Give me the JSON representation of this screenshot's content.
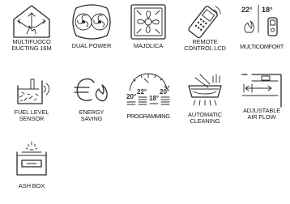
{
  "features": [
    {
      "id": "multifuoco",
      "icon": "house-airflow-icon",
      "label": "MULTIFUOCO\nDUCTING 16M"
    },
    {
      "id": "dual_power",
      "icon": "dual-fan-icon",
      "label": "DUAL POWER"
    },
    {
      "id": "majolica",
      "icon": "majolica-tile-icon",
      "label": "MAJOLICA"
    },
    {
      "id": "remote",
      "icon": "remote-control-icon",
      "label": "REMOTE\nCONTROL LCD"
    },
    {
      "id": "multicomfort",
      "icon": "thermostat-icon",
      "label": "MULTICOMFORT",
      "temps": [
        "22°",
        "18°"
      ]
    },
    {
      "id": "fuel_level",
      "icon": "fuel-level-icon",
      "label": "FUEL LEVEL\nSENSOR"
    },
    {
      "id": "energy_saving",
      "icon": "euro-flame-icon",
      "label": "ENERGY\nSAVING"
    },
    {
      "id": "programming",
      "icon": "programming-clock-icon",
      "label": "PROGRAMMING",
      "temps": [
        "20°",
        "22°",
        "18°",
        "20°"
      ]
    },
    {
      "id": "auto_cleaning",
      "icon": "cleaning-brazier-icon",
      "label": "AUTOMATIC\nCLEANING"
    },
    {
      "id": "adjustable_air",
      "icon": "air-flow-icon",
      "label": "ADJUSTABLE\nAIR FLOW"
    },
    {
      "id": "ash_box",
      "icon": "ash-box-icon",
      "label": "ASH BOX"
    }
  ]
}
